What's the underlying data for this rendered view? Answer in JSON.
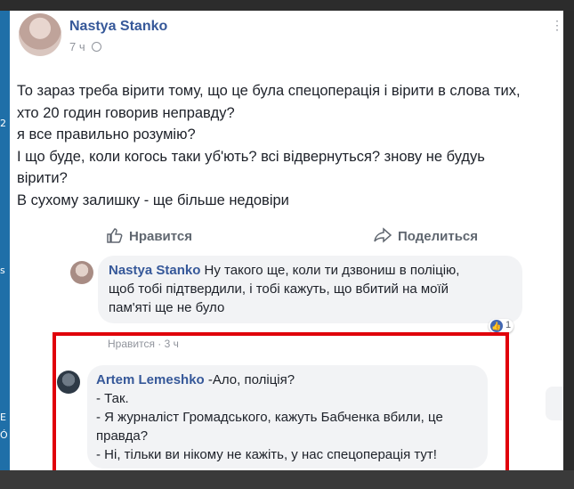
{
  "post": {
    "author": "Nastya Stanko",
    "time": "7 ч",
    "more_icon": "ellipsis-icon",
    "lines": [
      "То зараз треба вірити тому, що це була спецоперація і вірити в слова тих,",
      "хто 20 годин говорив неправду?",
      "я все правильно розумію?",
      "І що буде, коли когось таки уб'ють? всі відвернуться? знову не будуь",
      "вірити?",
      "В сухому залишку - ще більше недовіри"
    ]
  },
  "actions": {
    "like_label": "Нравится",
    "share_label": "Поделиться"
  },
  "comments": [
    {
      "author": "Nastya Stanko",
      "lines": [
        "Ну такого ще, коли ти дзвониш в поліцію,",
        "щоб тобі підтвердили, і тобі кажуть, що вбитий на моїй",
        "пам'яті ще не було"
      ],
      "reaction_count": "1",
      "meta": "Нравится · 3 ч"
    },
    {
      "author": "Artem Lemeshko",
      "lines": [
        "-Ало, поліція?",
        "- Так.",
        "- Я журналіст Громадського, кажуть Бабченка вбили, це",
        "правда?",
        "- Ні, тільки ви нікому не кажіть, у нас спецоперація тут!"
      ]
    }
  ],
  "highlight_color": "#e0000a",
  "link_color": "#365899"
}
